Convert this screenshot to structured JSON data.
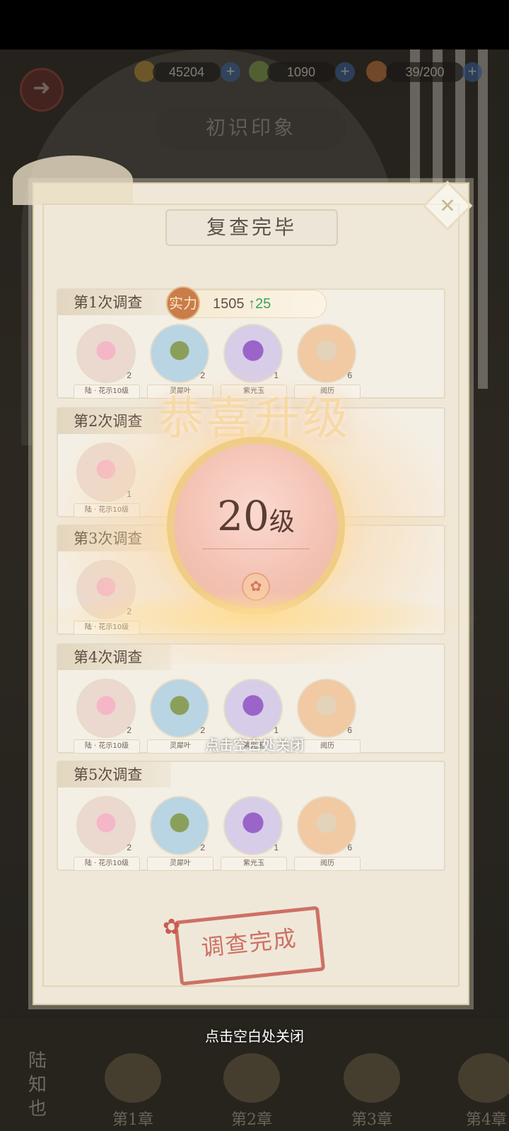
{
  "resources": [
    {
      "name": "coin",
      "value": "45204"
    },
    {
      "name": "gem",
      "value": "1090"
    },
    {
      "name": "stamina",
      "value": "39/200"
    }
  ],
  "page_title": "初识印象",
  "dialog": {
    "title": "复查完毕",
    "strength": {
      "badge": "实力",
      "value": "1505",
      "delta": "25"
    },
    "surveys": [
      {
        "label": "第1次调查",
        "items": [
          {
            "name": "陆 · 花示10级",
            "qty": "2",
            "kind": "flower"
          },
          {
            "name": "灵犀叶",
            "qty": "2",
            "kind": "leaf"
          },
          {
            "name": "紫光玉",
            "qty": "1",
            "kind": "jade"
          },
          {
            "name": "阅历",
            "qty": "6",
            "kind": "scroll"
          }
        ]
      },
      {
        "label": "第2次调查",
        "items": [
          {
            "name": "陆 · 花示10级",
            "qty": "1",
            "kind": "flower"
          }
        ]
      },
      {
        "label": "第3次调查",
        "items": [
          {
            "name": "陆 · 花示10级",
            "qty": "2",
            "kind": "flower"
          }
        ]
      },
      {
        "label": "第4次调查",
        "items": [
          {
            "name": "陆 · 花示10级",
            "qty": "2",
            "kind": "flower"
          },
          {
            "name": "灵犀叶",
            "qty": "2",
            "kind": "leaf"
          },
          {
            "name": "紫光玉",
            "qty": "1",
            "kind": "jade"
          },
          {
            "name": "阅历",
            "qty": "6",
            "kind": "scroll"
          }
        ]
      },
      {
        "label": "第5次调查",
        "items": [
          {
            "name": "陆 · 花示10级",
            "qty": "2",
            "kind": "flower"
          },
          {
            "name": "灵犀叶",
            "qty": "2",
            "kind": "leaf"
          },
          {
            "name": "紫光玉",
            "qty": "1",
            "kind": "jade"
          },
          {
            "name": "阅历",
            "qty": "6",
            "kind": "scroll"
          }
        ]
      }
    ],
    "stamp": "调查完成"
  },
  "levelup": {
    "title": "恭喜升级",
    "level": "20",
    "unit": "级",
    "tip": "点击空白处关闭"
  },
  "bottom_tip": "点击空白处关闭",
  "character_name": "陆知也",
  "chapters": [
    "第1章",
    "第2章",
    "第3章",
    "第4章"
  ]
}
